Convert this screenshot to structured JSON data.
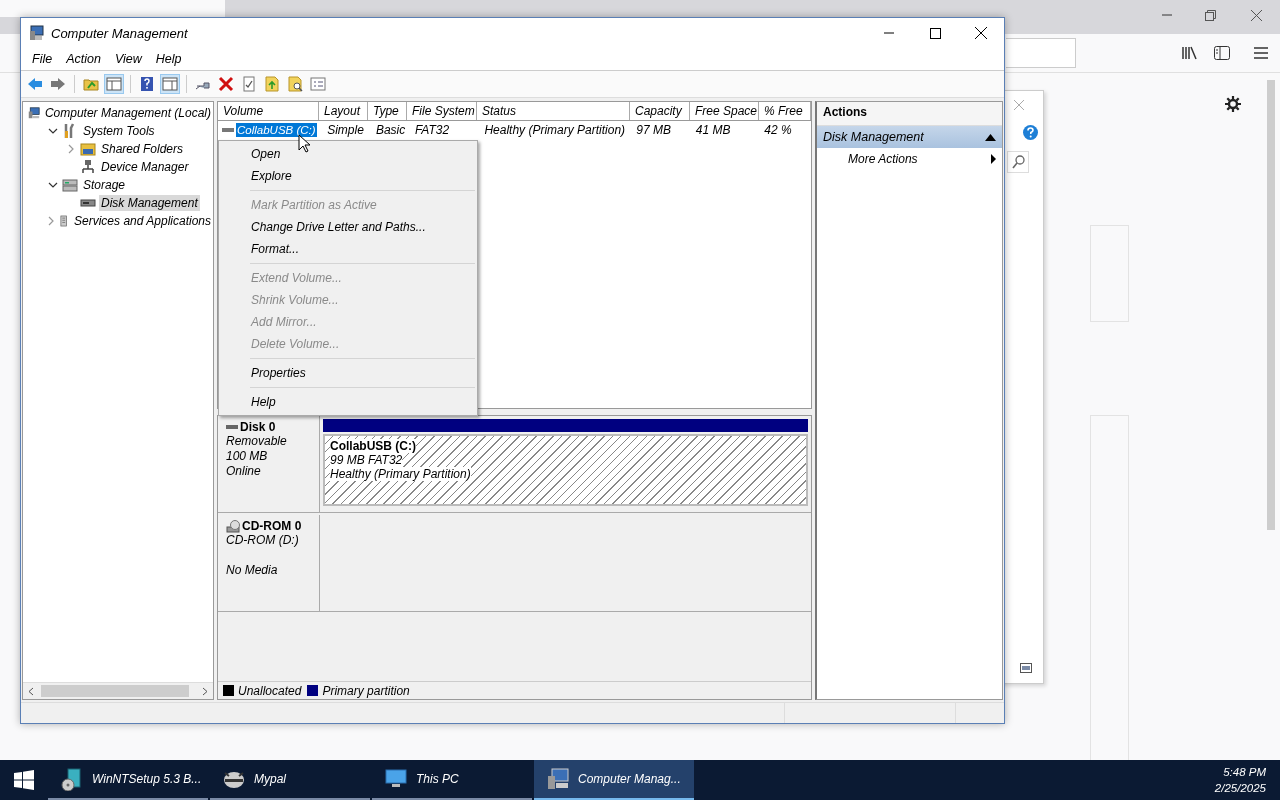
{
  "window": {
    "title": "Computer Management"
  },
  "menu_bar": [
    "File",
    "Action",
    "View",
    "Help"
  ],
  "tree": [
    {
      "label": "Computer Management (Local)",
      "selected": false,
      "children": [
        {
          "label": "System Tools",
          "expanded": true,
          "selected": false,
          "children": [
            {
              "label": "Shared Folders",
              "expanded": false,
              "selected": false
            },
            {
              "label": "Device Manager",
              "selected": false
            }
          ]
        },
        {
          "label": "Storage",
          "expanded": true,
          "selected": false,
          "children": [
            {
              "label": "Disk Management",
              "selected": true
            }
          ]
        },
        {
          "label": "Services and Applications",
          "expanded": false,
          "selected": false
        }
      ]
    }
  ],
  "volume_table": {
    "columns": [
      "Volume",
      "Layout",
      "Type",
      "File System",
      "Status",
      "Capacity",
      "Free Space",
      "% Free"
    ],
    "rows": [
      {
        "cells": [
          "CollabUSB (C:)",
          "Simple",
          "Basic",
          "FAT32",
          "Healthy (Primary Partition)",
          "97 MB",
          "41 MB",
          "42 %"
        ],
        "selected": true
      }
    ]
  },
  "context_menu": [
    {
      "kind": "item",
      "label": "Open",
      "disabled": false
    },
    {
      "kind": "item",
      "label": "Explore",
      "disabled": false
    },
    {
      "kind": "separator"
    },
    {
      "kind": "item",
      "label": "Mark Partition as Active",
      "disabled": true
    },
    {
      "kind": "item",
      "label": "Change Drive Letter and Paths...",
      "disabled": false
    },
    {
      "kind": "item",
      "label": "Format...",
      "disabled": false
    },
    {
      "kind": "separator"
    },
    {
      "kind": "item",
      "label": "Extend Volume...",
      "disabled": true
    },
    {
      "kind": "item",
      "label": "Shrink Volume...",
      "disabled": true
    },
    {
      "kind": "item",
      "label": "Add Mirror...",
      "disabled": true
    },
    {
      "kind": "item",
      "label": "Delete Volume...",
      "disabled": true
    },
    {
      "kind": "separator"
    },
    {
      "kind": "item",
      "label": "Properties",
      "disabled": false
    },
    {
      "kind": "separator"
    },
    {
      "kind": "item",
      "label": "Help",
      "disabled": false
    }
  ],
  "disks": [
    {
      "kind": "disk",
      "name": "Disk 0",
      "type": "Removable",
      "size": "100 MB",
      "status": "Online",
      "partitions": [
        {
          "name": "CollabUSB  (C:)",
          "size": "99 MB FAT32",
          "status": "Healthy (Primary Partition)",
          "color": "#000080"
        }
      ]
    },
    {
      "kind": "cdrom",
      "name": "CD-ROM 0",
      "type": "CD-ROM (D:)",
      "status": "No Media"
    }
  ],
  "legend": [
    {
      "label": "Unallocated",
      "color": "#000000"
    },
    {
      "label": "Primary partition",
      "color": "#000080"
    }
  ],
  "actions": {
    "title": "Actions",
    "sections": [
      {
        "label": "Disk Management",
        "expanded": true,
        "items": [
          "More Actions"
        ]
      }
    ]
  },
  "taskbar": {
    "items": [
      {
        "label": "WinNTSetup 5.3 B...",
        "selected": false
      },
      {
        "label": "Mypal",
        "selected": false
      },
      {
        "label": "This PC",
        "selected": false
      },
      {
        "label": "Computer Manag...",
        "selected": true
      }
    ],
    "time": "5:48 PM",
    "date": "2/25/2025"
  }
}
